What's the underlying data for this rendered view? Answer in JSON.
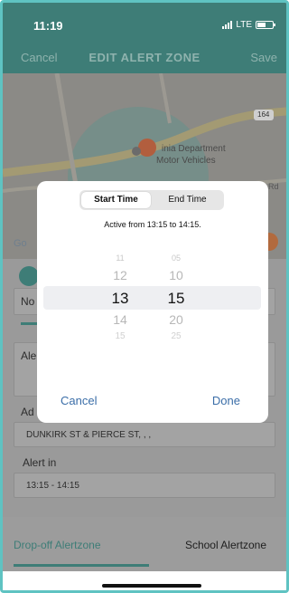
{
  "status": {
    "time": "11:19",
    "network": "LTE"
  },
  "header": {
    "cancel_label": "Cancel",
    "title": "EDIT ALERT ZONE",
    "save_label": "Save"
  },
  "map": {
    "place_label_line1": "inia Department",
    "place_label_line2": "Motor Vehicles",
    "route_shield": "164",
    "road_suffix": "Rd",
    "google_logo": "Go"
  },
  "form": {
    "name_label_partial": "No",
    "alert_label_partial": "Ale",
    "address_label_partial": "Ad",
    "address_value": "DUNKIRK ST & PIERCE ST, , ,",
    "alert_in_label": "Alert in",
    "alert_in_value": "13:15 - 14:15"
  },
  "tabs": {
    "left": "Drop-off Alertzone",
    "right": "School Alertzone"
  },
  "modal": {
    "segments": {
      "start": "Start Time",
      "end": "End Time"
    },
    "active_text": "Active from 13:15 to 14:15.",
    "hours": [
      "11",
      "12",
      "13",
      "14",
      "15"
    ],
    "minutes": [
      "05",
      "10",
      "15",
      "20",
      "25"
    ],
    "cancel_label": "Cancel",
    "done_label": "Done"
  },
  "colors": {
    "teal": "#3e7d77",
    "link_blue": "#3b6ea8",
    "border": "#5fc3c2"
  }
}
